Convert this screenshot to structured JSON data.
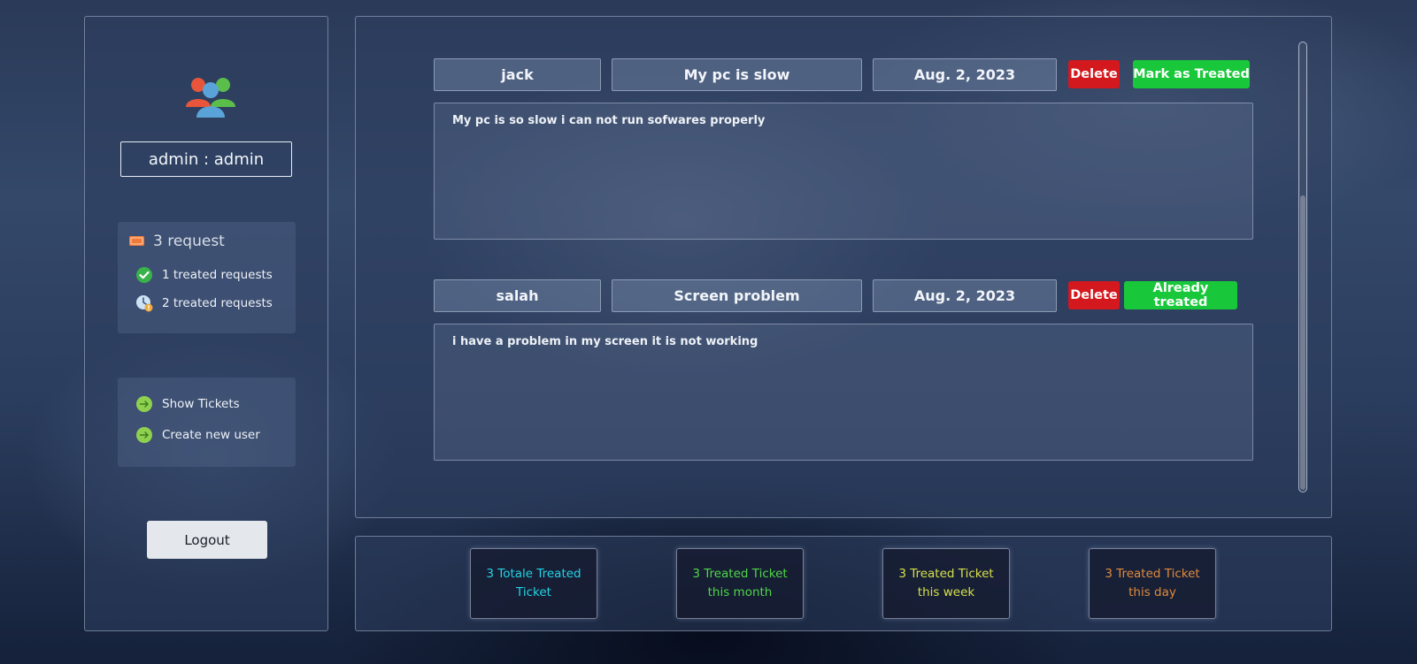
{
  "sidebar": {
    "user_label": "admin : admin",
    "requests": {
      "count_label": "3 request",
      "treated_label": "1 treated requests",
      "pending_label": "2 treated requests"
    },
    "menu": {
      "show_tickets": "Show Tickets",
      "create_user": "Create new user"
    },
    "logout_label": "Logout"
  },
  "tickets": [
    {
      "name": "jack",
      "subject": "My pc is slow",
      "date": "Aug. 2, 2023",
      "delete_label": "Delete",
      "action_label": "Mark as Treated",
      "description": "My pc is so slow i can not run sofwares properly"
    },
    {
      "name": "salah",
      "subject": "Screen problem",
      "date": "Aug. 2, 2023",
      "delete_label": "Delete",
      "action_label": "Already treated",
      "description": "i have a problem in my screen it is not working"
    }
  ],
  "stats": [
    {
      "label": "3 Totale Treated Ticket",
      "color": "#22d3e6"
    },
    {
      "label": "3 Treated Ticket this month",
      "color": "#4fd648"
    },
    {
      "label": "3 Treated Ticket this week",
      "color": "#d6e04a"
    },
    {
      "label": "3 Treated Ticket this day",
      "color": "#e08a3c"
    }
  ],
  "colors": {
    "delete": "#d3181e",
    "treat": "#19c83a"
  },
  "icons": {
    "users": "users-group-icon",
    "requests": "ticket-icon",
    "treated": "check-circle-icon",
    "pending": "clock-alert-icon",
    "menu_arrow": "arrow-right-circle-icon"
  }
}
